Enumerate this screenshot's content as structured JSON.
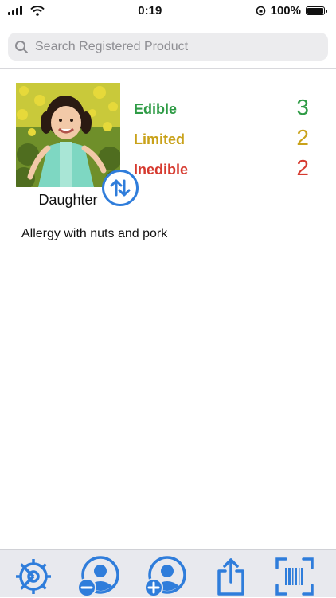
{
  "status_bar": {
    "time": "0:19",
    "battery_percent": "100%"
  },
  "search": {
    "placeholder": "Search Registered Product",
    "value": ""
  },
  "profile": {
    "name": "Daughter",
    "note": "Allergy with nuts and pork",
    "stats": [
      {
        "label": "Edible",
        "count": "3",
        "color": "#2e9b45"
      },
      {
        "label": "Limited",
        "count": "2",
        "color": "#c9a21a"
      },
      {
        "label": "Inedible",
        "count": "2",
        "color": "#d63a2f"
      }
    ]
  },
  "toolbar": {
    "accent_color": "#2f7ddb",
    "items": [
      {
        "icon": "settings-gear-icon"
      },
      {
        "icon": "remove-person-icon"
      },
      {
        "icon": "add-person-icon"
      },
      {
        "icon": "share-icon"
      },
      {
        "icon": "barcode-scan-icon"
      }
    ]
  }
}
